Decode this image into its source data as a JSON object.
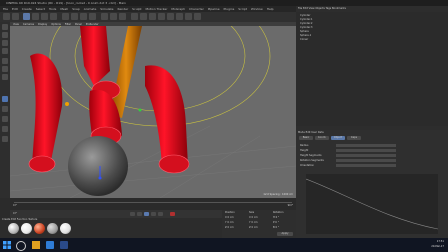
{
  "window": {
    "title": "CINEMA 4D R19.024 Studio (RC - R19) - [toon_rocket - 0 Anim dot 3 .c4d] - Main"
  },
  "menu": {
    "items": [
      "File",
      "Edit",
      "Create",
      "Select",
      "Tools",
      "Mesh",
      "Snap",
      "Animate",
      "Simulate",
      "Render",
      "Sculpt",
      "Motion Tracker",
      "MoGraph",
      "Character",
      "Pipeline",
      "Plugins",
      "Script",
      "Window",
      "Help"
    ]
  },
  "viewport": {
    "menu": [
      "View",
      "Cameras",
      "Display",
      "Options",
      "Filter",
      "Panel",
      "ProRender"
    ],
    "label": "Perspective",
    "grid_spacing": "Grid Spacing : 1000 cm"
  },
  "timeline": {
    "start": "0 F",
    "end": "90 F",
    "current": "0 F"
  },
  "materials": {
    "menu": [
      "Create",
      "Edit",
      "Function",
      "Texture"
    ],
    "swatches": [
      "#b4b4b4",
      "#ffffff",
      "#c84020",
      "#9a9a9a",
      "#e0e0e0"
    ]
  },
  "coordinates": {
    "headers": [
      "Position",
      "Size",
      "Rotation"
    ],
    "rows": [
      [
        "X 0 cm",
        "X 0 cm",
        "H 0 °"
      ],
      [
        "Y 0 cm",
        "Y 0 cm",
        "P 0 °"
      ],
      [
        "Z 0 cm",
        "Z 0 cm",
        "B 0 °"
      ]
    ],
    "apply_label": "Apply"
  },
  "object_manager": {
    "menu": [
      "File",
      "Edit",
      "View",
      "Objects",
      "Tags",
      "Bookmarks"
    ],
    "objects": [
      "Cylinder",
      "Cylinder.1",
      "Cylinder.2",
      "Cylinder.3",
      "Sphere",
      "Sphere.1",
      "Cloner"
    ]
  },
  "attributes": {
    "menu": [
      "Mode",
      "Edit",
      "User Data"
    ],
    "tabs": [
      "Basic",
      "Coord.",
      "Object",
      "Caps"
    ],
    "fields": [
      "Radius",
      "Height",
      "Height Segments",
      "Rotation Segments",
      "Orientation"
    ]
  },
  "taskbar": {
    "time": "17:51",
    "date": "29-Mar-17"
  }
}
